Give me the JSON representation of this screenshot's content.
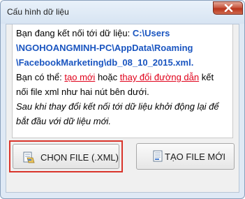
{
  "window": {
    "title": "Cấu hình dữ liệu"
  },
  "message": {
    "line1_prefix": "Bạn đang kết nối tới dữ liệu: ",
    "path_line1": "C:\\Users",
    "path_line2": "\\NGOHOANGMINH-PC\\AppData\\Roaming",
    "path_line3": "\\FacebookMarketing\\db_08_10_2015.xml.",
    "line4_prefix": "Bạn có thể: ",
    "link_create": "tạo mới",
    "line4_mid": " hoặc ",
    "link_change": "thay đổi đường dẫn",
    "line4_suffix": " kết",
    "line5": "nối file xml như hai nút bên dưới.",
    "note_line1": "Sau khi thay đổi kết nối tới dữ liệu khởi động lại để",
    "note_line2": "bắt đầu với dữ liệu mới."
  },
  "buttons": {
    "choose_file": "CHỌN FILE (.XML)",
    "create_file": "TẠO FILE MỚI"
  },
  "icons": {
    "close": "close-icon",
    "choose": "open-file-icon",
    "create": "new-file-icon"
  }
}
